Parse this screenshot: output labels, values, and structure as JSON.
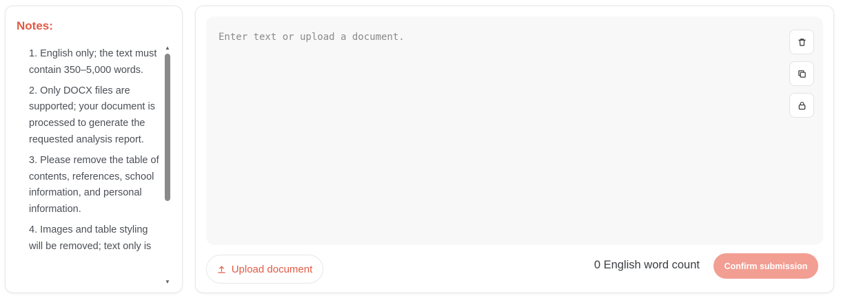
{
  "notes": {
    "title": "Notes:",
    "items": [
      "1. English only; the text must contain 350–5,000 words.",
      "2. Only DOCX files are supported; your document is processed to generate the requested analysis report.",
      "3. Please remove the table of contents, references, school information, and personal information.",
      "4. Images and table styling will be removed; text only is"
    ],
    "scroll_up_icon": "triangle-up",
    "scroll_down_icon": "triangle-down"
  },
  "editor": {
    "placeholder": "Enter text or upload a document.",
    "value": "",
    "tools": [
      {
        "name": "delete",
        "icon": "trash-icon"
      },
      {
        "name": "copy",
        "icon": "copy-icon"
      },
      {
        "name": "lock",
        "icon": "lock-icon"
      }
    ]
  },
  "footer": {
    "upload_label": "Upload document",
    "upload_icon": "upload-icon",
    "word_count_text": "0 English word count",
    "confirm_label": "Confirm submission"
  },
  "colors": {
    "accent": "#e05a45",
    "confirm_disabled_bg": "#f29e93",
    "editor_bg": "#f8f8f8",
    "border": "#e5e7eb"
  }
}
